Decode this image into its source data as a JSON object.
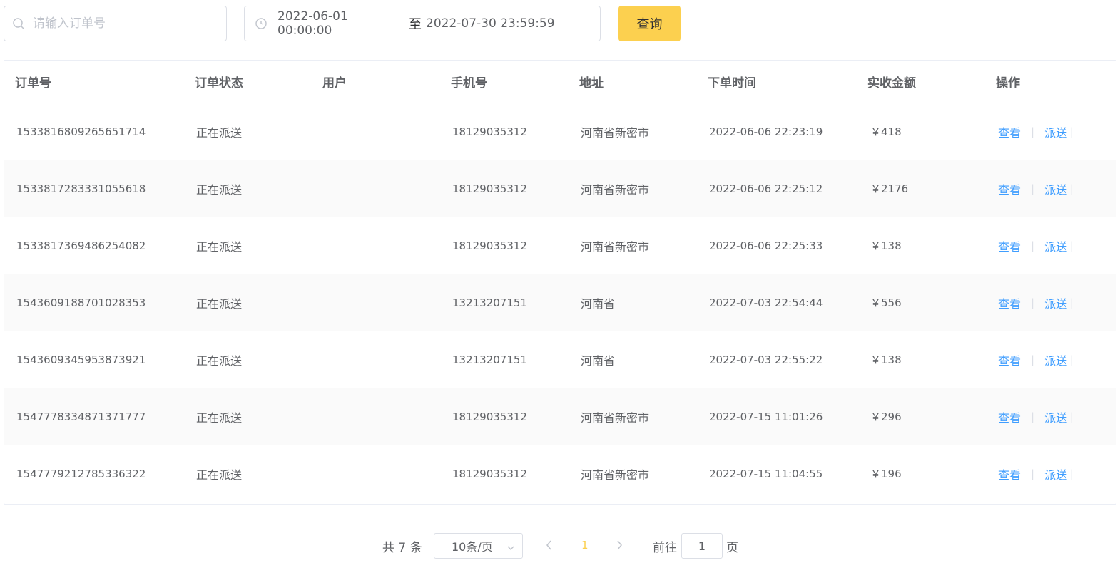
{
  "search": {
    "placeholder": "请输入订单号",
    "icon": "search-icon"
  },
  "date_range": {
    "start": "2022-06-01 00:00:00",
    "separator": "至",
    "end": "2022-07-30 23:59:59",
    "icon": "clock-icon"
  },
  "query_button": {
    "label": "查询",
    "color": "#fcd04f"
  },
  "table": {
    "headers": [
      "订单号",
      "订单状态",
      "用户",
      "手机号",
      "地址",
      "下单时间",
      "实收金额",
      "操作"
    ],
    "rows": [
      {
        "order_no": "1533816809265651714",
        "status": "正在派送",
        "user": "",
        "phone": "18129035312",
        "address": "河南省新密市",
        "time": "2022-06-06 22:23:19",
        "amount": "￥418",
        "view": "查看",
        "dispatch": "派送"
      },
      {
        "order_no": "1533817283331055618",
        "status": "正在派送",
        "user": "",
        "phone": "18129035312",
        "address": "河南省新密市",
        "time": "2022-06-06 22:25:12",
        "amount": "￥2176",
        "view": "查看",
        "dispatch": "派送"
      },
      {
        "order_no": "1533817369486254082",
        "status": "正在派送",
        "user": "",
        "phone": "18129035312",
        "address": "河南省新密市",
        "time": "2022-06-06 22:25:33",
        "amount": "￥138",
        "view": "查看",
        "dispatch": "派送"
      },
      {
        "order_no": "1543609188701028353",
        "status": "正在派送",
        "user": "",
        "phone": "13213207151",
        "address": "河南省",
        "time": "2022-07-03 22:54:44",
        "amount": "￥556",
        "view": "查看",
        "dispatch": "派送"
      },
      {
        "order_no": "1543609345953873921",
        "status": "正在派送",
        "user": "",
        "phone": "13213207151",
        "address": "河南省",
        "time": "2022-07-03 22:55:22",
        "amount": "￥138",
        "view": "查看",
        "dispatch": "派送"
      },
      {
        "order_no": "1547778334871371777",
        "status": "正在派送",
        "user": "",
        "phone": "18129035312",
        "address": "河南省新密市",
        "time": "2022-07-15 11:01:26",
        "amount": "￥296",
        "view": "查看",
        "dispatch": "派送"
      },
      {
        "order_no": "1547779212785336322",
        "status": "正在派送",
        "user": "",
        "phone": "18129035312",
        "address": "河南省新密市",
        "time": "2022-07-15 11:04:55",
        "amount": "￥196",
        "view": "查看",
        "dispatch": "派送"
      }
    ]
  },
  "pagination": {
    "total": "共 7 条",
    "page_size": "10条/页",
    "current_page": "1",
    "goto_label": "前往",
    "goto_value": "1",
    "page_suffix": "页",
    "active_color": "#fcd04f"
  },
  "colors": {
    "link": "#409eff",
    "border": "#dcdfe6",
    "stripe": "#fafafa"
  }
}
